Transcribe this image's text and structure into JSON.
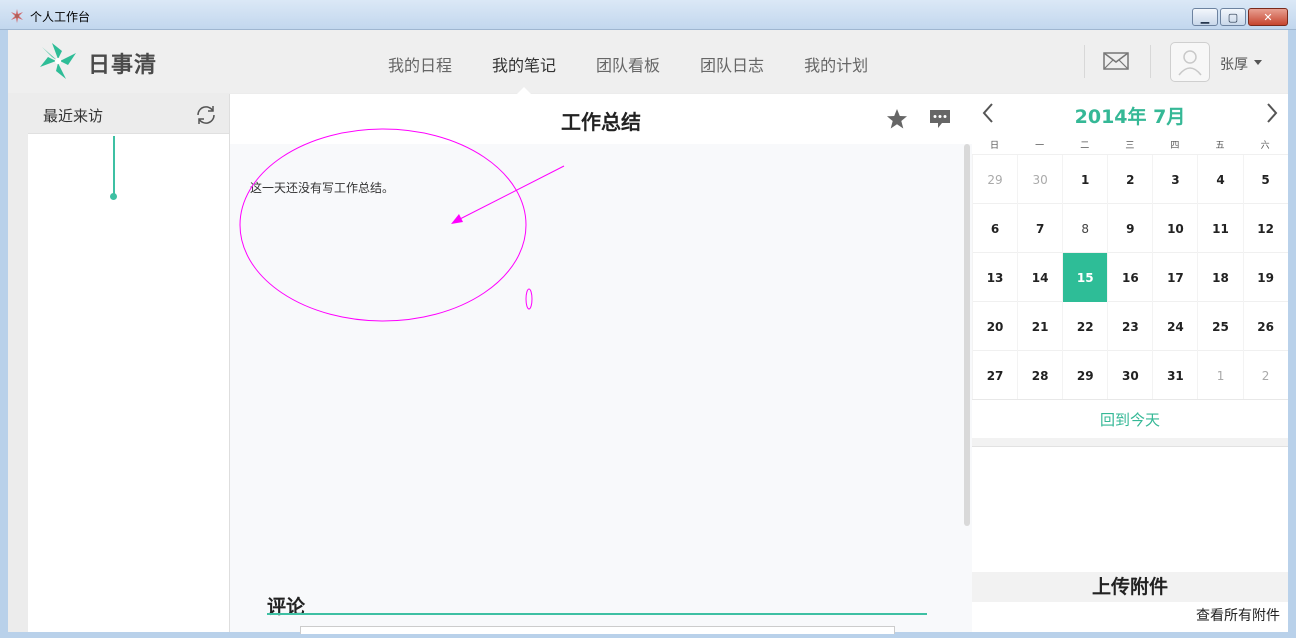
{
  "window": {
    "title": "个人工作台"
  },
  "app": {
    "logo_text": "日事清"
  },
  "nav": {
    "items": [
      {
        "label": "我的日程"
      },
      {
        "label": "我的笔记",
        "active": true
      },
      {
        "label": "团队看板"
      },
      {
        "label": "团队日志"
      },
      {
        "label": "我的计划"
      }
    ]
  },
  "user": {
    "name": "张厚"
  },
  "left_panel": {
    "title": "最近来访"
  },
  "note": {
    "title": "工作总结",
    "empty_text": "这一天还没有写工作总结。",
    "comments_label": "评论"
  },
  "calendar": {
    "title": "2014年 7月",
    "weekdays": [
      "日",
      "一",
      "二",
      "三",
      "四",
      "五",
      "六"
    ],
    "weeks": [
      [
        "29",
        "30",
        "1",
        "2",
        "3",
        "4",
        "5"
      ],
      [
        "6",
        "7",
        "8",
        "9",
        "10",
        "11",
        "12"
      ],
      [
        "13",
        "14",
        "15",
        "16",
        "17",
        "18",
        "19"
      ],
      [
        "20",
        "21",
        "22",
        "23",
        "24",
        "25",
        "26"
      ],
      [
        "27",
        "28",
        "29",
        "30",
        "31",
        "1",
        "2"
      ]
    ],
    "today_label": "回到今天",
    "selected_day": "15"
  },
  "attachments": {
    "title": "上传附件",
    "view_all": "查看所有附件"
  },
  "colors": {
    "accent": "#2ebd97",
    "annotation": "#ff00ff"
  }
}
